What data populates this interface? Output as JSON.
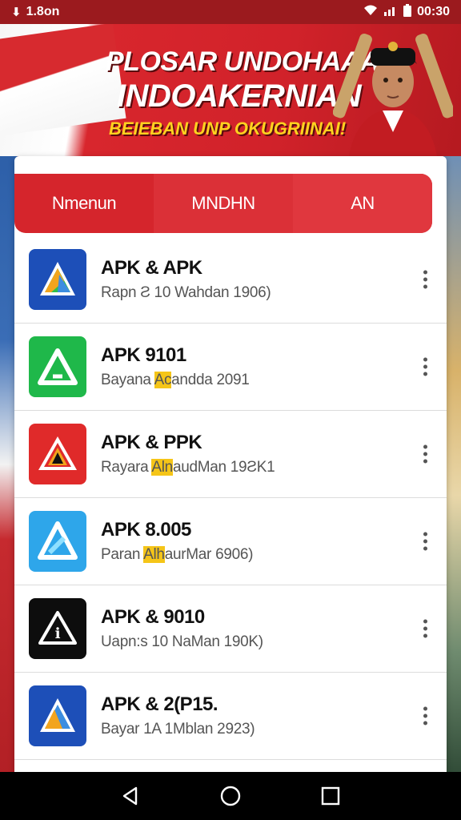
{
  "status_bar": {
    "left_text": "1.8on",
    "right_text": "00:30"
  },
  "banner": {
    "title_line1": "PLOSAR UNDOHAAAN",
    "title_line2": "INDOAKERNIAN",
    "subtitle": "BEIEBAN UNP OKUGRIINAI!"
  },
  "tabs": [
    {
      "label": "Nmenun"
    },
    {
      "label": "MNDHN"
    },
    {
      "label": "AN"
    }
  ],
  "apps": [
    {
      "title": "APK & APK",
      "subtitle": "Rapn Ƨ 10 Wahdan 1906)",
      "highlight": "",
      "icon": "apk-blue-green-icon",
      "bg": "#1d4fb8"
    },
    {
      "title": "APK 9101",
      "subtitle_pre": "Bayana ",
      "highlight": "Ac",
      "subtitle_post": "andda 2091",
      "icon": "apk-green-icon",
      "bg": "#1fb84a"
    },
    {
      "title": "APK & PPK",
      "subtitle_pre": "Rayara ",
      "highlight": "Aln",
      "subtitle_post": "audMan 19ƧK1",
      "icon": "apk-red-icon",
      "bg": "#e02a2a"
    },
    {
      "title": "APK 8.005",
      "subtitle_pre": "Paran ",
      "highlight": "Alh",
      "subtitle_post": "aurMar 6906)",
      "icon": "apk-light-blue-icon",
      "bg": "#2ea6ea"
    },
    {
      "title": "APK & 9010",
      "subtitle": "Uapn:s 10 NaMan 190K)",
      "highlight": "",
      "icon": "apk-black-icon",
      "bg": "#0d0d0d"
    },
    {
      "title": "APK & 2(P15.",
      "subtitle": "Bayar 1A 1Mblan 2923)",
      "highlight": "",
      "icon": "apk-blue-orange-icon",
      "bg": "#1d4fb8"
    }
  ],
  "nav": {
    "back": "back-icon",
    "home": "home-icon",
    "recents": "recents-icon"
  }
}
